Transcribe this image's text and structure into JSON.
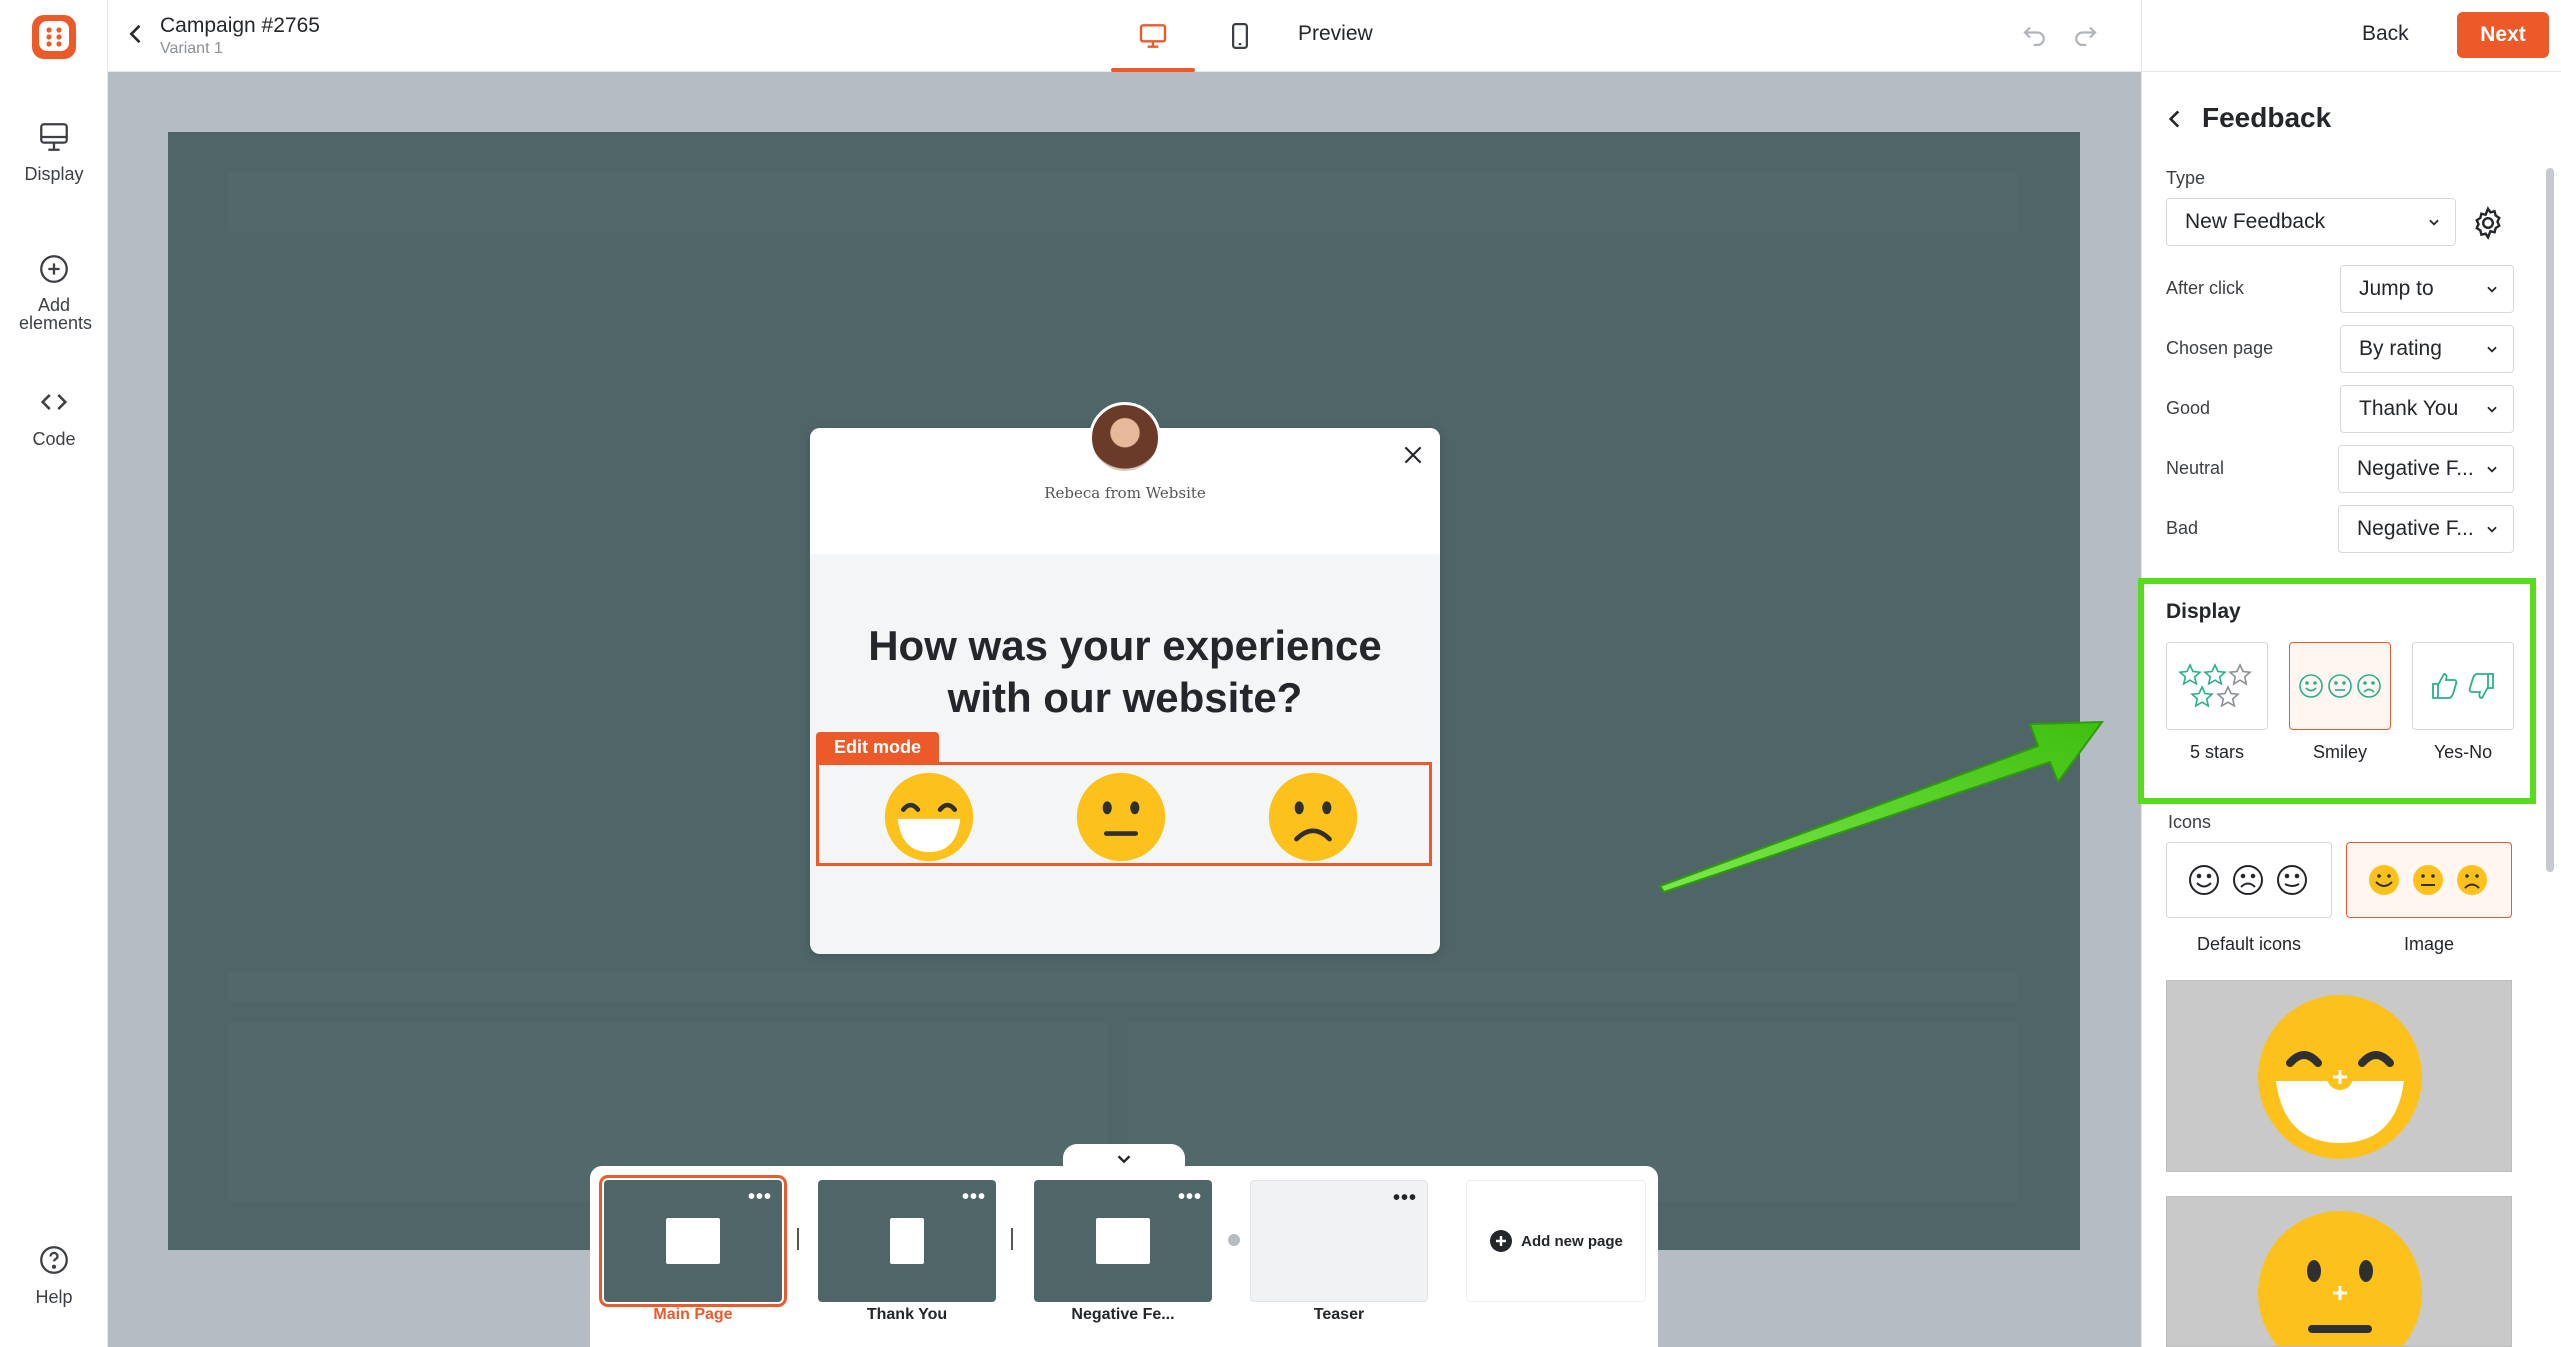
{
  "rail": {
    "items": [
      {
        "label": "Display",
        "icon": "monitor-icon"
      },
      {
        "label": "Add elements",
        "icon": "plus-circle-icon"
      },
      {
        "label": "Code",
        "icon": "code-icon"
      },
      {
        "label": "Help",
        "icon": "help-icon"
      }
    ]
  },
  "topbar": {
    "campaign_title": "Campaign #2765",
    "variant": "Variant 1",
    "preview_label": "Preview",
    "back_label": "Back",
    "next_label": "Next"
  },
  "popup": {
    "sender": "Rebeca from Website",
    "question": "How was your experience with our website?",
    "edit_mode_label": "Edit mode"
  },
  "pages": [
    {
      "label": "Main Page",
      "active": true
    },
    {
      "label": "Thank You",
      "active": false
    },
    {
      "label": "Negative Fe...",
      "active": false
    },
    {
      "label": "Teaser",
      "active": false
    }
  ],
  "add_page_label": "Add new page",
  "panel": {
    "title": "Feedback",
    "type_label": "Type",
    "type_value": "New Feedback",
    "after_click_label": "After click",
    "after_click_value": "Jump to",
    "chosen_page_label": "Chosen page",
    "chosen_page_value": "By rating",
    "good_label": "Good",
    "good_value": "Thank You",
    "neutral_label": "Neutral",
    "neutral_value": "Negative F...",
    "bad_label": "Bad",
    "bad_value": "Negative F...",
    "display_title": "Display",
    "display_options": [
      {
        "label": "5 stars",
        "selected": false
      },
      {
        "label": "Smiley",
        "selected": true
      },
      {
        "label": "Yes-No",
        "selected": false
      }
    ],
    "icons_label": "Icons",
    "icon_options": [
      {
        "label": "Default icons",
        "selected": false
      },
      {
        "label": "Image",
        "selected": true
      }
    ]
  },
  "colors": {
    "accent": "#ed5a29",
    "canvas": "#4f6568",
    "highlight": "#58dc1e",
    "emoji": "#fcc21b"
  }
}
